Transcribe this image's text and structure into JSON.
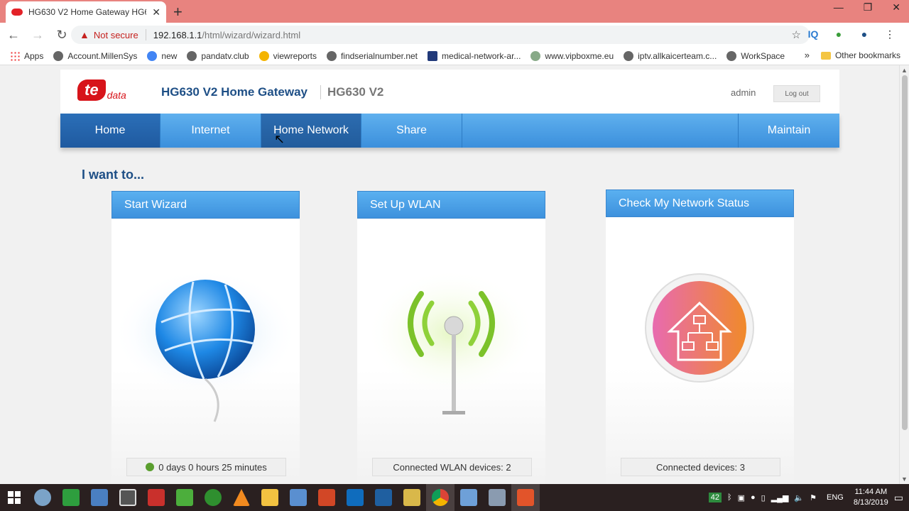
{
  "browser": {
    "tab_title": "HG630 V2 Home Gateway HG630",
    "new_tab": "+",
    "minimize": "—",
    "restore": "❐",
    "close": "✕",
    "not_secure": "Not secure",
    "url_host": "192.168.1.1",
    "url_path": "/html/wizard/wizard.html",
    "extensions": [
      "IQ",
      "ext-globe",
      "ext-avatar",
      "menu"
    ]
  },
  "bookmarks": {
    "items": [
      "Apps",
      "Account.MillenSys",
      "new",
      "pandatv.club",
      "viewreports",
      "findserialnumber.net",
      "medical-network-ar...",
      "www.vipboxme.eu",
      "iptv.allkaicerteam.c...",
      "WorkSpace"
    ],
    "more": "»",
    "other": "Other bookmarks"
  },
  "header": {
    "logo_te": "te",
    "logo_data": "data",
    "brand": "HG630 V2 Home Gateway",
    "model": "HG630 V2",
    "user": "admin",
    "logout": "Log out"
  },
  "nav": [
    "Home",
    "Internet",
    "Home Network",
    "Share",
    "Maintain"
  ],
  "section_title": "I want to...",
  "cards": [
    {
      "title": "Start Wizard",
      "status": "0 days 0 hours 25 minutes"
    },
    {
      "title": "Set Up WLAN",
      "status": "Connected WLAN devices: 2"
    },
    {
      "title": "Check My Network Status",
      "status": "Connected devices: 3"
    }
  ],
  "taskbar": {
    "lang": "ENG",
    "badge": "42",
    "time": "11:44 AM",
    "date": "8/13/2019"
  },
  "colors": {
    "nav_blue": "#3b8fdc",
    "nav_active": "#1f5aa0",
    "brand_blue": "#1e4f86",
    "logo_red": "#d7141a"
  }
}
